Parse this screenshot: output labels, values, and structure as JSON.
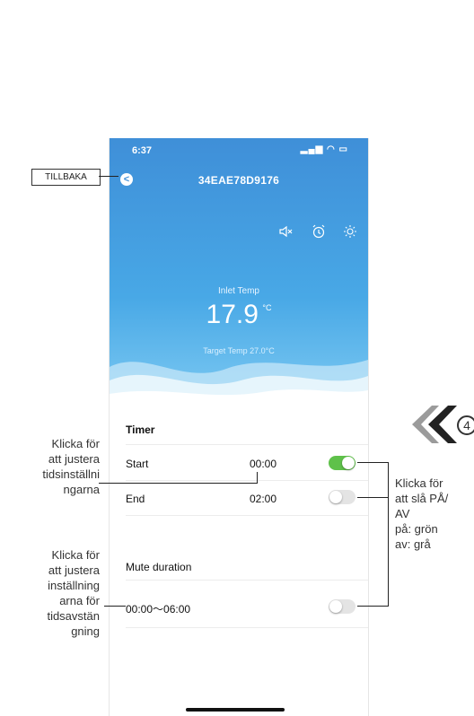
{
  "status_bar": {
    "time": "6:37",
    "icons": "signal wifi battery"
  },
  "header": {
    "back_label": "<",
    "device_id": "34EAE78D9176"
  },
  "hero": {
    "icons": [
      "mute-icon",
      "alarm-clock-icon",
      "brightness-icon"
    ],
    "inlet_label": "Inlet Temp",
    "temp_value": "17.9",
    "temp_unit": "°C",
    "target_label": "Target Temp",
    "target_value": "27.0°C"
  },
  "timer": {
    "section_title": "Timer",
    "start_label": "Start",
    "start_value": "00:00",
    "start_toggle": "on",
    "end_label": "End",
    "end_value": "02:00",
    "end_toggle": "off"
  },
  "mute": {
    "section_title": "Mute duration",
    "range": "00:00～06:00",
    "toggle": "off"
  },
  "annotations": {
    "back": "TILLBAKA",
    "timer_note": [
      "Klicka för",
      "att justera",
      "tidsinställni",
      "ngarna"
    ],
    "mute_note": [
      "Klicka för",
      "att justera",
      "inställning",
      "arna för",
      "tidsavstän",
      "gning"
    ],
    "toggle_note": [
      "Klicka för",
      "att slå PÅ/",
      "AV",
      "på: grön",
      "av: grå"
    ],
    "step_number": "4"
  },
  "colors": {
    "hero_top": "#3f8fd8",
    "toggle_on": "#5fc14a",
    "toggle_off": "#e4e4e4"
  }
}
